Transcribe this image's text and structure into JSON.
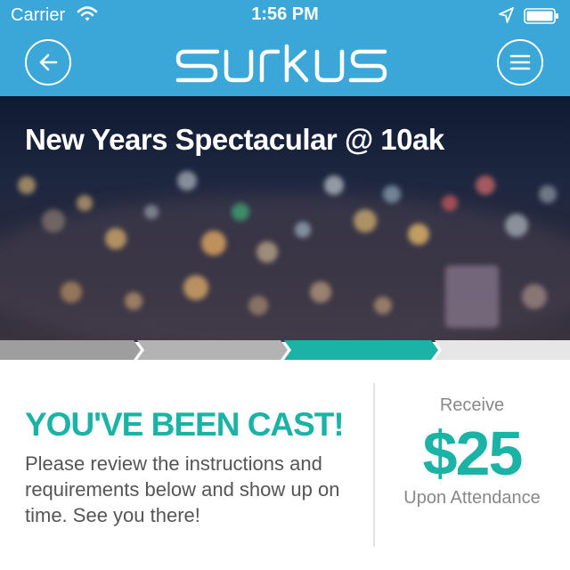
{
  "status_bar": {
    "carrier": "Carrier",
    "time": "1:56 PM"
  },
  "nav": {
    "logo_text": "surkus",
    "back_icon": "arrow-left-icon",
    "menu_icon": "hamburger-menu-icon",
    "bar_color": "#3aa7d8"
  },
  "event": {
    "title": "New Years Spectacular @ 10ak"
  },
  "progress": {
    "steps": 4,
    "current_step": 3,
    "completed_color": "#9e9e9e",
    "current_color": "#1ab3a6",
    "pending_color": "#e6e6e6"
  },
  "cast": {
    "heading": "YOU'VE BEEN CAST!",
    "body": "Please review the instructions and requirements below and show up on time. See you there!"
  },
  "payout": {
    "pre": "Receive",
    "amount": "$25",
    "post": "Upon Attendance",
    "accent": "#1ab3a6"
  }
}
